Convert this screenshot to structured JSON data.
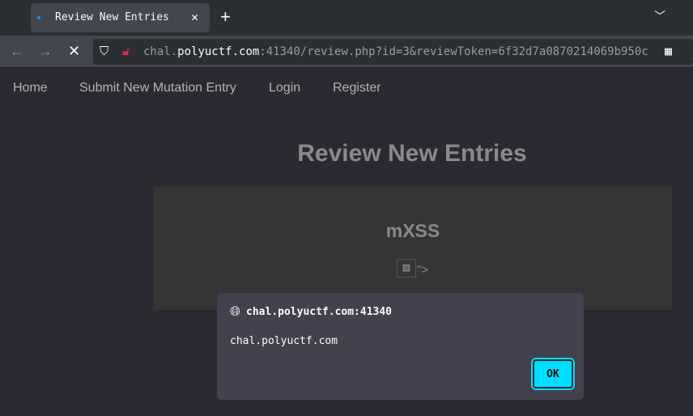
{
  "tab": {
    "title": "Review New Entries"
  },
  "url": {
    "scheme_host_prefix": "chal.",
    "host": "polyuctf.com",
    "rest": ":41340/review.php?id=3&reviewToken=6f32d7a0870214069b950c"
  },
  "menu": [
    "Home",
    "Submit New Mutation Entry",
    "Login",
    "Register"
  ],
  "page": {
    "title": "Review New Entries",
    "entry_title": "mXSS",
    "entry_suffix": "\">"
  },
  "dialog": {
    "origin": "chal.polyuctf.com:41340",
    "message": "chal.polyuctf.com",
    "ok": "OK"
  }
}
